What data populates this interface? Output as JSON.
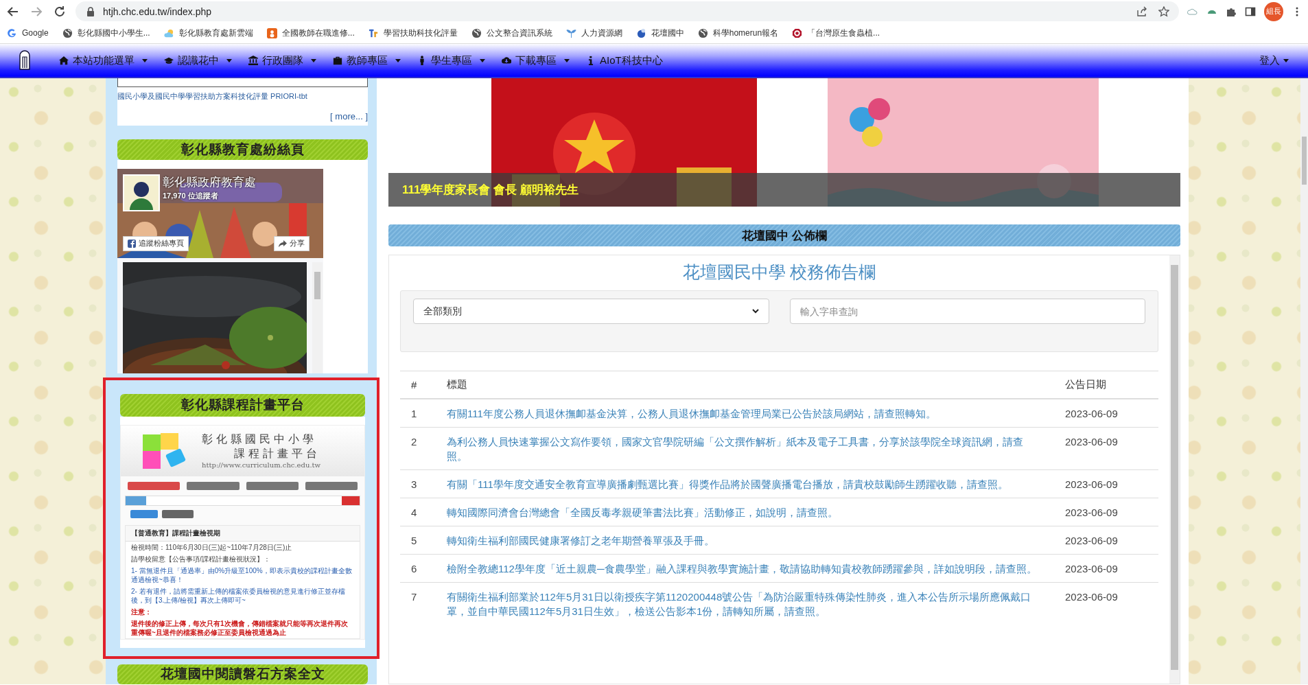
{
  "browser": {
    "address": "htjh.chc.edu.tw/index.php",
    "profile": "組長"
  },
  "bookmarks": [
    {
      "label": "Google",
      "kind": "google"
    },
    {
      "label": "彰化縣國中小學生...",
      "kind": "globe"
    },
    {
      "label": "彰化縣教育處新雲端",
      "kind": "cloud"
    },
    {
      "label": "全國教師在職進修...",
      "kind": "orange"
    },
    {
      "label": "學習扶助科技化評量",
      "kind": "letters"
    },
    {
      "label": "公文整合資訊系統",
      "kind": "globe"
    },
    {
      "label": "人力資源網",
      "kind": "sprout"
    },
    {
      "label": "花壇國中",
      "kind": "ball"
    },
    {
      "label": "科學homerun報名",
      "kind": "globe"
    },
    {
      "label": "「台灣原生食蟲植...",
      "kind": "ring"
    }
  ],
  "nav": {
    "items": [
      {
        "label": "本站功能選單",
        "kind": "home",
        "dropdown": true
      },
      {
        "label": "認識花中",
        "kind": "cap",
        "dropdown": true
      },
      {
        "label": "行政團隊",
        "kind": "bank",
        "dropdown": true
      },
      {
        "label": "教師專區",
        "kind": "briefcase",
        "dropdown": true
      },
      {
        "label": "學生專區",
        "kind": "person",
        "dropdown": true
      },
      {
        "label": "下載專區",
        "kind": "cloud",
        "dropdown": true
      },
      {
        "label": "AIoT科技中心",
        "kind": "info",
        "dropdown": false
      }
    ],
    "login": "登入"
  },
  "sidebar": {
    "top_link": "國民小學及國民中學學習扶助方案科技化評量 PRIORI-tbt",
    "more": "[ more... ]",
    "fan_page": {
      "heading": "彰化縣教育處紛絲頁",
      "page_name": "彰化縣政府教育處",
      "followers": "17,970 位追蹤者",
      "follow_button": "追蹤粉絲專頁",
      "share_button": "分享"
    },
    "curriculum": {
      "heading": "彰化縣課程計畫平台",
      "highlighted": true,
      "screenshot": {
        "title_1": "彰化縣國民中小學",
        "title_2": "課程計畫平台",
        "url": "http://www.curriculum.chc.edu.tw",
        "notice_title": "【普通教育】課程計畫檢視期",
        "lines": [
          {
            "kind": "plain",
            "text": "檢視時間：110年6月30日(三)起~110年7月28日(三)止"
          },
          {
            "kind": "plain",
            "text": "請學校留意【公告事項/課程計畫檢視狀況】："
          },
          {
            "kind": "blue",
            "text": "1- 當無退件且「通過率」由0%升級至100%，即表示貴校的課程計畫全數通過檢視~恭喜！"
          },
          {
            "kind": "blue",
            "text": "2- 若有退件，請將需重新上傳的檔案依委員檢視的意見進行修正並存檔後，到【3.上傳/檢視】再次上傳即可~"
          },
          {
            "kind": "red",
            "text": "注意："
          },
          {
            "kind": "red",
            "text": "退件後的修正上傳，每次只有1次機會，傳錯檔案就只能等再次退件再次重傳喔~且退件的檔案務必修正至委員檢視通過為止"
          }
        ]
      }
    },
    "next_heading": "花壇國中閱讀磐石方案全文"
  },
  "banner": {
    "caption": "111學年度家長會 會長 顧明裕先生"
  },
  "board": {
    "heading": "花壇國中 公佈欄",
    "title": "花壇國民中學 校務佈告欄",
    "category": "全部類別",
    "search_placeholder": "輸入字串查詢",
    "columns": [
      "#",
      "標題",
      "公告日期"
    ],
    "rows": [
      {
        "number": "1",
        "title": "有關111年度公務人員退休撫卹基金決算，公務人員退休撫卹基金管理局業已公告於該局網站，請查照轉知。",
        "date": "2023-06-09"
      },
      {
        "number": "2",
        "title": "為利公務人員快速掌握公文寫作要領，國家文官學院研編「公文撰作解析」紙本及電子工具書，分享於該學院全球資訊網，請查照。",
        "date": "2023-06-09"
      },
      {
        "number": "3",
        "title": "有關「111學年度交通安全教育宣導廣播劇甄選比賽」得獎作品將於國聲廣播電台播放，請貴校鼓勵師生踴躍收聽，請查照。",
        "date": "2023-06-09"
      },
      {
        "number": "4",
        "title": "轉知國際同濟會台灣總會「全國反毒孝親硬筆書法比賽」活動修正，如說明，請查照。",
        "date": "2023-06-09"
      },
      {
        "number": "5",
        "title": "轉知衛生福利部國民健康署修訂之老年期營養單張及手冊。",
        "date": "2023-06-09"
      },
      {
        "number": "6",
        "title": "檢附全教總112學年度「近土親農─食農學堂」融入課程與教學實施計畫，敬請協助轉知貴校教師踴躍參與，詳如說明段，請查照。",
        "date": "2023-06-09"
      },
      {
        "number": "7",
        "title": "有關衛生福利部業於112年5月31日以衛授疾字第1120200448號公告「為防治嚴重特殊傳染性肺炎，進入本公告所示場所應佩戴口罩，並自中華民國112年5月31日生效」，檢送公告影本1份，請轉知所屬，請查照。",
        "date": "2023-06-09"
      }
    ]
  }
}
